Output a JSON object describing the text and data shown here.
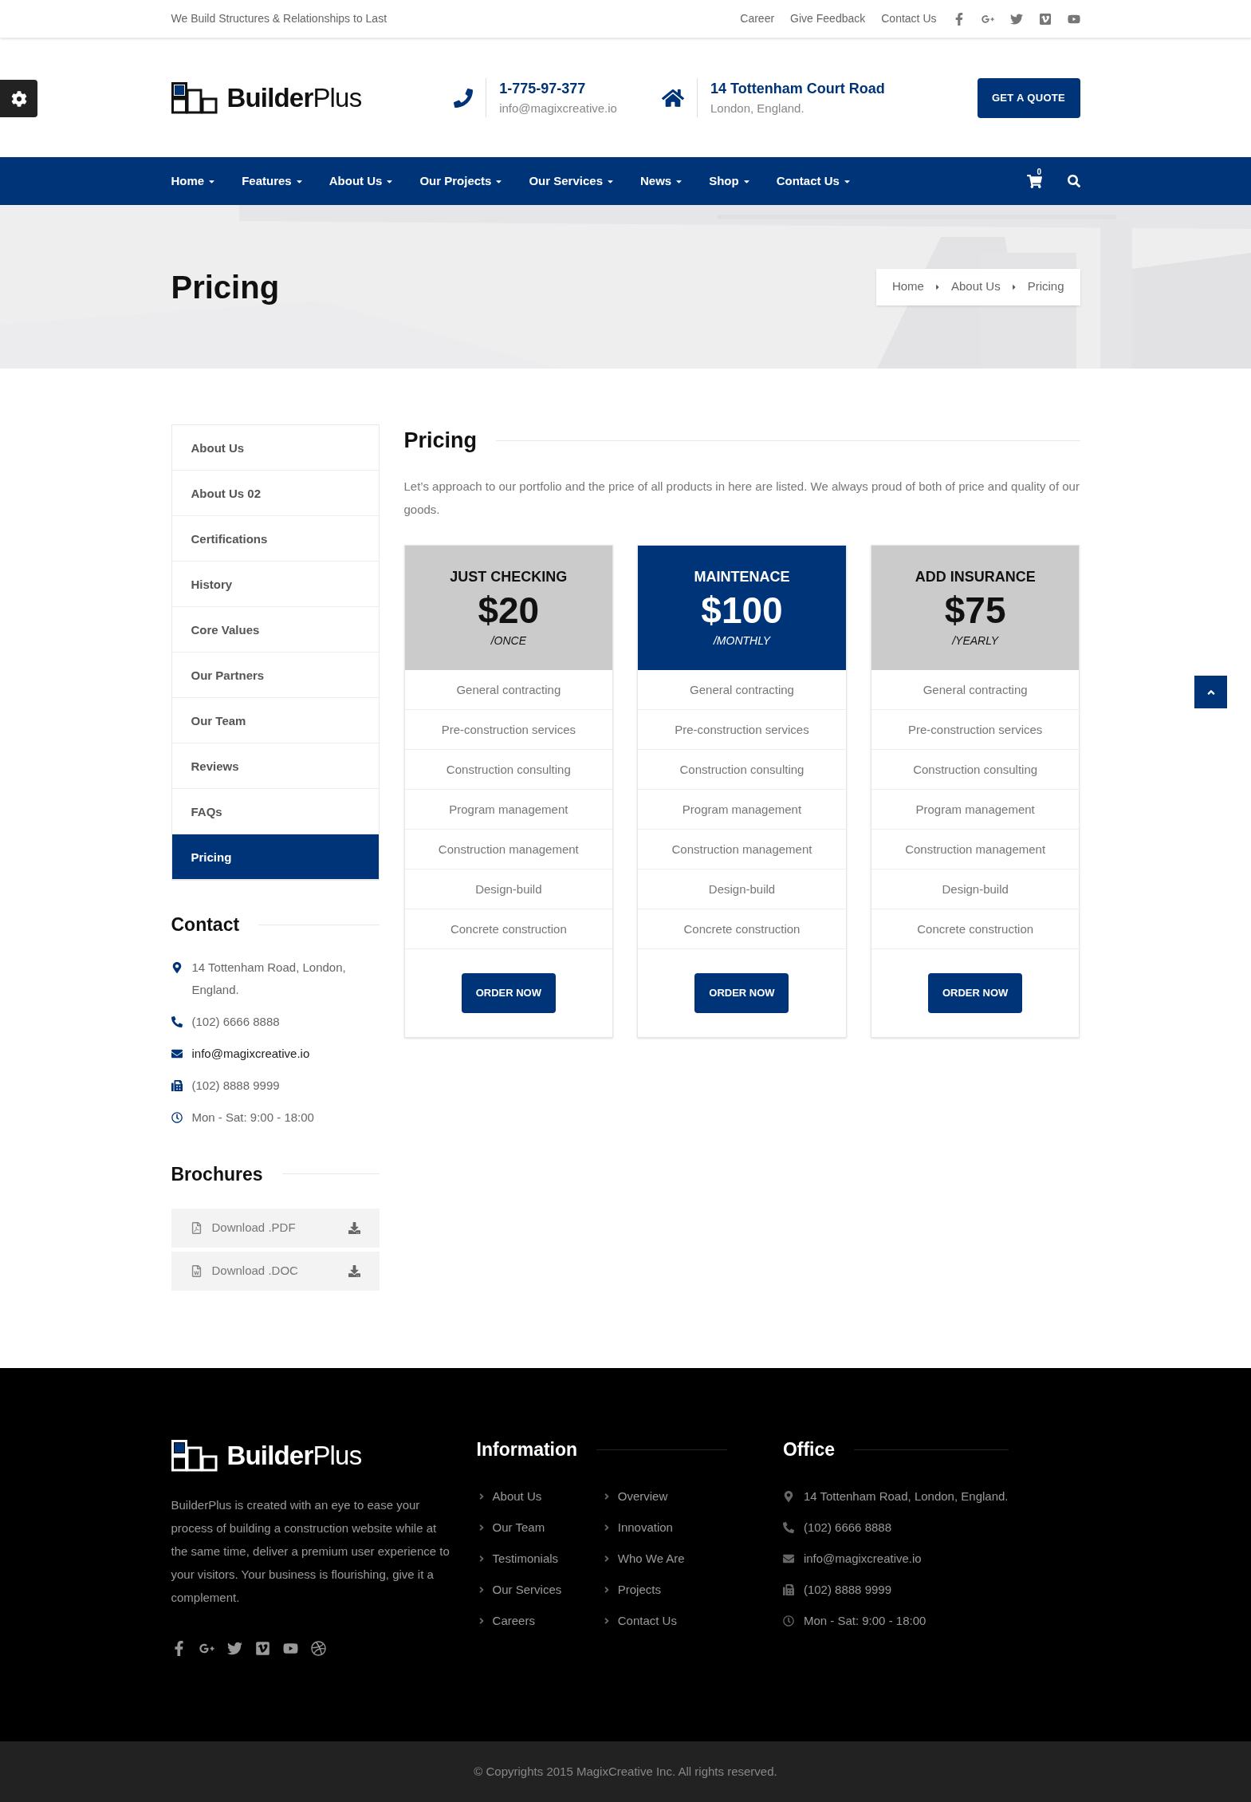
{
  "topbar": {
    "tagline": "We Build Structures & Relationships to Last",
    "links": [
      "Career",
      "Give Feedback",
      "Contact Us"
    ]
  },
  "header": {
    "logo": "**Builder**Plus",
    "phone": "1-775-97-377",
    "email": "info@magixcreative.io",
    "address": "14 Tottenham Court Road",
    "city": "London, England.",
    "quote_button": "GET A QUOTE"
  },
  "nav": {
    "items": [
      "Home",
      "Features",
      "About Us",
      "Our Projects",
      "Our Services",
      "News",
      "Shop",
      "Contact Us"
    ],
    "cart_count": "0"
  },
  "hero": {
    "title": "Pricing",
    "breadcrumb": [
      "Home",
      "About Us",
      "Pricing"
    ]
  },
  "sidebar": {
    "items": [
      {
        "label": "About Us",
        "selected": false
      },
      {
        "label": "About Us 02",
        "selected": false
      },
      {
        "label": "Certifications",
        "selected": false
      },
      {
        "label": "History",
        "selected": false
      },
      {
        "label": "Core Values",
        "selected": false
      },
      {
        "label": "Our Partners",
        "selected": false
      },
      {
        "label": "Our Team",
        "selected": false
      },
      {
        "label": "Reviews",
        "selected": false
      },
      {
        "label": "FAQs",
        "selected": false
      },
      {
        "label": "Pricing",
        "selected": true
      }
    ],
    "contact_title": "Contact",
    "contact": [
      {
        "kind": "location",
        "text": "14 Tottenham Road, London, England."
      },
      {
        "kind": "phone",
        "text": "(102) 6666 8888"
      },
      {
        "kind": "email",
        "text": "info@magixcreative.io"
      },
      {
        "kind": "fax",
        "text": "(102) 8888 9999"
      },
      {
        "kind": "hours",
        "text": "Mon - Sat: 9:00 - 18:00"
      }
    ],
    "brochures_title": "Brochures",
    "brochures": [
      {
        "kind": "pdf",
        "label": "Download .PDF"
      },
      {
        "kind": "doc",
        "label": "Download .DOC"
      }
    ]
  },
  "content": {
    "title": "Pricing",
    "intro": "Let’s approach to our portfolio and the price of all products in here are listed. We always proud of both of price and quality of our goods.",
    "plans": [
      {
        "name": "JUST CHECKING",
        "price": "$20",
        "period": "/ONCE",
        "featured": false,
        "features": [
          "General contracting",
          "Pre-construction services",
          "Construction consulting",
          "Program management",
          "Construction management",
          "Design-build",
          "Concrete construction"
        ],
        "button": "ORDER NOW"
      },
      {
        "name": "MAINTENACE",
        "price": "$100",
        "period": "/MONTHLY",
        "featured": true,
        "features": [
          "General contracting",
          "Pre-construction services",
          "Construction consulting",
          "Program management",
          "Construction management",
          "Design-build",
          "Concrete construction"
        ],
        "button": "ORDER NOW"
      },
      {
        "name": "ADD INSURANCE",
        "price": "$75",
        "period": "/YEARLY",
        "featured": false,
        "features": [
          "General contracting",
          "Pre-construction services",
          "Construction consulting",
          "Program management",
          "Construction management",
          "Design-build",
          "Concrete construction"
        ],
        "button": "ORDER NOW"
      }
    ]
  },
  "footer": {
    "logo": "**Builder**Plus",
    "about": "BuilderPlus is created with an eye to ease your process of building a construction website while at the same time, deliver a premium user experience to your visitors. Your business is flourishing, give it a complement.",
    "information_title": "Information",
    "links": [
      "About Us",
      "Overview",
      "Our Team",
      "Innovation",
      "Testimonials",
      "Who We Are",
      "Our Services",
      "Projects",
      "Careers",
      "Contact Us"
    ],
    "office_title": "Office",
    "office": [
      {
        "kind": "location",
        "text": "14 Tottenham Road, London, England."
      },
      {
        "kind": "phone",
        "text": "(102) 6666 8888"
      },
      {
        "kind": "email",
        "text": "info@magixcreative.io"
      },
      {
        "kind": "fax",
        "text": "(102) 8888 9999"
      },
      {
        "kind": "hours",
        "text": "Mon - Sat: 9:00 - 18:00"
      }
    ],
    "copyright": "© Copyrights 2015 MagixCreative Inc. All rights reserved."
  }
}
